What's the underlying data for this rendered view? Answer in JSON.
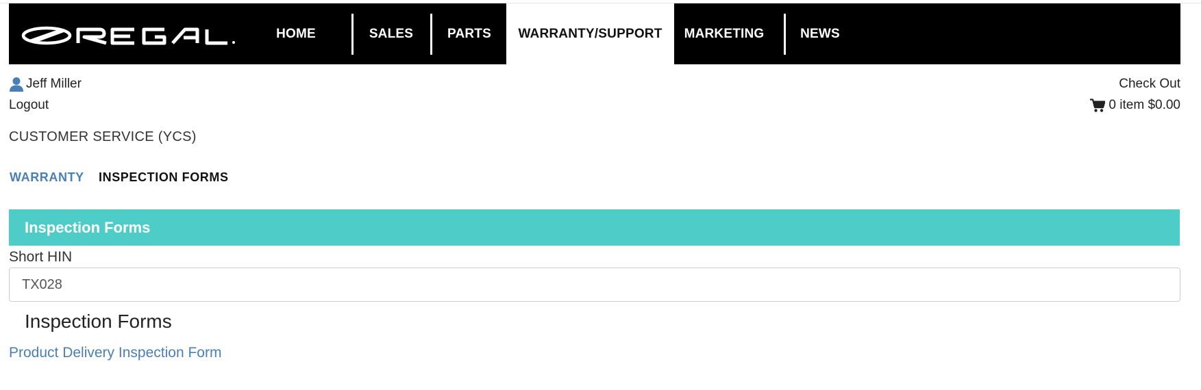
{
  "brand": {
    "logo_text": "REGAL"
  },
  "nav": {
    "items": [
      {
        "label": "HOME"
      },
      {
        "label": "SALES"
      },
      {
        "label": "PARTS"
      },
      {
        "label": "WARRANTY/SUPPORT",
        "active": true
      },
      {
        "label": "MARKETING"
      },
      {
        "label": "NEWS"
      }
    ]
  },
  "user": {
    "name": "Jeff Miller",
    "logout_label": "Logout",
    "icon": "user-icon"
  },
  "cart": {
    "checkout_label": "Check Out",
    "summary": "0 item $0.00",
    "icon": "cart-icon"
  },
  "section": {
    "title": "CUSTOMER SERVICE (YCS)"
  },
  "sub_nav": {
    "warranty_label": "WARRANTY",
    "inspection_label": "INSPECTION FORMS"
  },
  "panel": {
    "header": "Inspection Forms",
    "field_label": "Short HIN",
    "field_value": "TX028",
    "forms_heading": "Inspection Forms",
    "form_link": "Product Delivery Inspection Form"
  },
  "colors": {
    "navbar_bg": "#000000",
    "panel_header_bg": "#4ecdc8",
    "link_color": "#4a7fb5",
    "user_icon_color": "#4a7fb5"
  }
}
